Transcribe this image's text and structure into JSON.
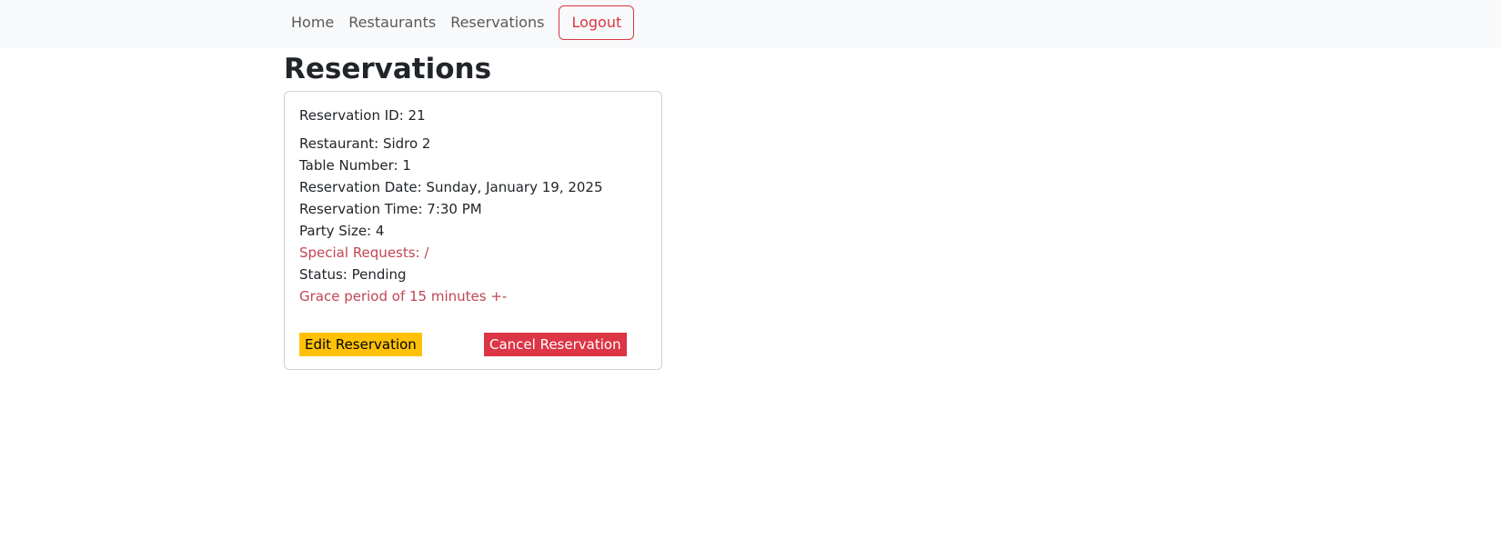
{
  "nav": {
    "items": [
      {
        "label": "Home"
      },
      {
        "label": "Restaurants"
      },
      {
        "label": "Reservations"
      }
    ],
    "logout_label": "Logout"
  },
  "page": {
    "title": "Reservations"
  },
  "reservation": {
    "id_line": "Reservation ID: 21",
    "restaurant_line": "Restaurant: Sidro 2",
    "table_line": "Table Number: 1",
    "date_line": "Reservation Date: Sunday, January 19, 2025",
    "time_line": "Reservation Time: 7:30 PM",
    "party_line": "Party Size: 4",
    "requests_line": "Special Requests: /",
    "status_line": "Status: Pending",
    "grace_line": "Grace period of 15 minutes +-",
    "edit_label": "Edit Reservation",
    "cancel_label": "Cancel Reservation"
  },
  "colors": {
    "navbar_bg": "#f8f9fa",
    "danger": "#dc3545",
    "warning": "#ffc107",
    "text": "#212529"
  }
}
